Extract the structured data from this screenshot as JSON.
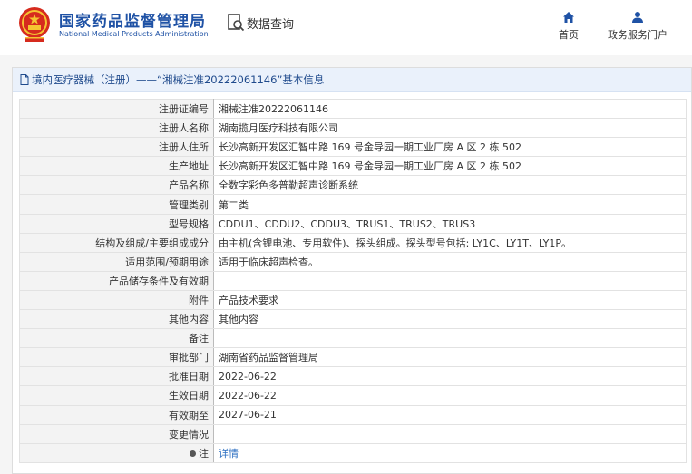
{
  "header": {
    "logo_cn": "国家药品监督管理局",
    "logo_en": "National Medical Products Administration",
    "query_label": "数据查询",
    "nav": {
      "home": "首页",
      "service": "政务服务门户"
    }
  },
  "panel": {
    "title": "境内医疗器械（注册）——“湘械注准20222061146”基本信息"
  },
  "rows": [
    {
      "label": "注册证编号",
      "value": "湘械注准20222061146"
    },
    {
      "label": "注册人名称",
      "value": "湖南揽月医疗科技有限公司"
    },
    {
      "label": "注册人住所",
      "value": "长沙高新开发区汇智中路 169 号金导园一期工业厂房 A 区 2 栋 502"
    },
    {
      "label": "生产地址",
      "value": "长沙高新开发区汇智中路 169 号金导园一期工业厂房 A 区 2 栋 502"
    },
    {
      "label": "产品名称",
      "value": "全数字彩色多普勒超声诊断系统"
    },
    {
      "label": "管理类别",
      "value": "第二类"
    },
    {
      "label": "型号规格",
      "value": "CDDU1、CDDU2、CDDU3、TRUS1、TRUS2、TRUS3"
    },
    {
      "label": "结构及组成/主要组成成分",
      "value": "由主机(含锂电池、专用软件)、探头组成。探头型号包括: LY1C、LY1T、LY1P。"
    },
    {
      "label": "适用范围/预期用途",
      "value": "适用于临床超声检查。"
    },
    {
      "label": "产品储存条件及有效期",
      "value": ""
    },
    {
      "label": "附件",
      "value": "产品技术要求"
    },
    {
      "label": "其他内容",
      "value": "其他内容"
    },
    {
      "label": "备注",
      "value": ""
    },
    {
      "label": "审批部门",
      "value": "湖南省药品监督管理局"
    },
    {
      "label": "批准日期",
      "value": "2022-06-22"
    },
    {
      "label": "生效日期",
      "value": "2022-06-22"
    },
    {
      "label": "有效期至",
      "value": "2027-06-21"
    },
    {
      "label": "变更情况",
      "value": ""
    }
  ],
  "note": {
    "label": "注",
    "link": "详情"
  }
}
